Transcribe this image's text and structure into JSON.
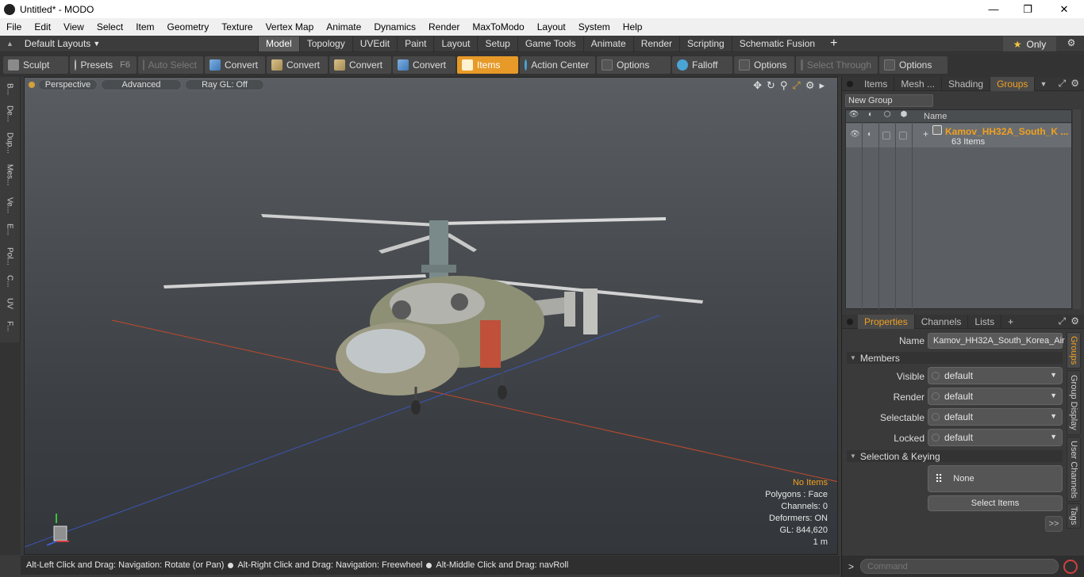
{
  "window": {
    "title": "Untitled* - MODO",
    "controls": [
      "—",
      "❐",
      "✕"
    ]
  },
  "menubar": [
    "File",
    "Edit",
    "View",
    "Select",
    "Item",
    "Geometry",
    "Texture",
    "Vertex Map",
    "Animate",
    "Dynamics",
    "Render",
    "MaxToModo",
    "Layout",
    "System",
    "Help"
  ],
  "layout_bar": {
    "layouts_label": "Default Layouts",
    "tabs": [
      "Model",
      "Topology",
      "UVEdit",
      "Paint",
      "Layout",
      "Setup",
      "Game Tools",
      "Animate",
      "Render",
      "Scripting",
      "Schematic Fusion"
    ],
    "active_tab": "Model",
    "only_label": "Only"
  },
  "toolbar": {
    "sculpt": "Sculpt",
    "presets": "Presets",
    "presets_key": "F6",
    "auto_select": "Auto Select",
    "convert1": "Convert",
    "convert2": "Convert",
    "convert3": "Convert",
    "convert4": "Convert",
    "items": "Items",
    "action_center": "Action Center",
    "options1": "Options",
    "falloff": "Falloff",
    "options2": "Options",
    "select_through": "Select Through",
    "options3": "Options"
  },
  "left_tabs": [
    "B...",
    "De...",
    "Dup...",
    "Mes...",
    "Ve...",
    "E...",
    "Pol...",
    "C...",
    "UV",
    "F..."
  ],
  "viewport": {
    "view_mode": "Perspective",
    "advanced": "Advanced",
    "raygl": "Ray GL: Off",
    "stats": {
      "items": "No Items",
      "polygons": "Polygons : Face",
      "channels": "Channels: 0",
      "deformers": "Deformers: ON",
      "gl": "GL: 844,620",
      "scale": "1 m"
    }
  },
  "statusbar": {
    "hint1": "Alt-Left Click and Drag: Navigation: Rotate (or Pan)",
    "hint2": "Alt-Right Click and Drag: Navigation: Freewheel",
    "hint3": "Alt-Middle Click and Drag: navRoll"
  },
  "groups_panel": {
    "tabs": [
      "Items",
      "Mesh ...",
      "Shading",
      "Groups"
    ],
    "active_tab": "Groups",
    "new_group": "New Group",
    "column_name": "Name",
    "group_name": "Kamov_HH32A_South_K ...",
    "group_count": "63 Items"
  },
  "properties_panel": {
    "tabs": [
      "Properties",
      "Channels",
      "Lists"
    ],
    "active_tab": "Properties",
    "name_label": "Name",
    "name_value": "Kamov_HH32A_South_Korea_Air",
    "members_section": "Members",
    "visible_label": "Visible",
    "visible_value": "default",
    "render_label": "Render",
    "render_value": "default",
    "selectable_label": "Selectable",
    "selectable_value": "default",
    "locked_label": "Locked",
    "locked_value": "default",
    "selection_section": "Selection & Keying",
    "none_label": "None",
    "select_items": "Select Items",
    "more": ">>"
  },
  "right_vertical_tabs": [
    "Groups",
    "Group Display",
    "User Channels",
    "Tags"
  ],
  "command": {
    "prompt": ">",
    "placeholder": "Command"
  },
  "colors": {
    "accent": "#f0a020",
    "active_tool": "#e79a28"
  }
}
